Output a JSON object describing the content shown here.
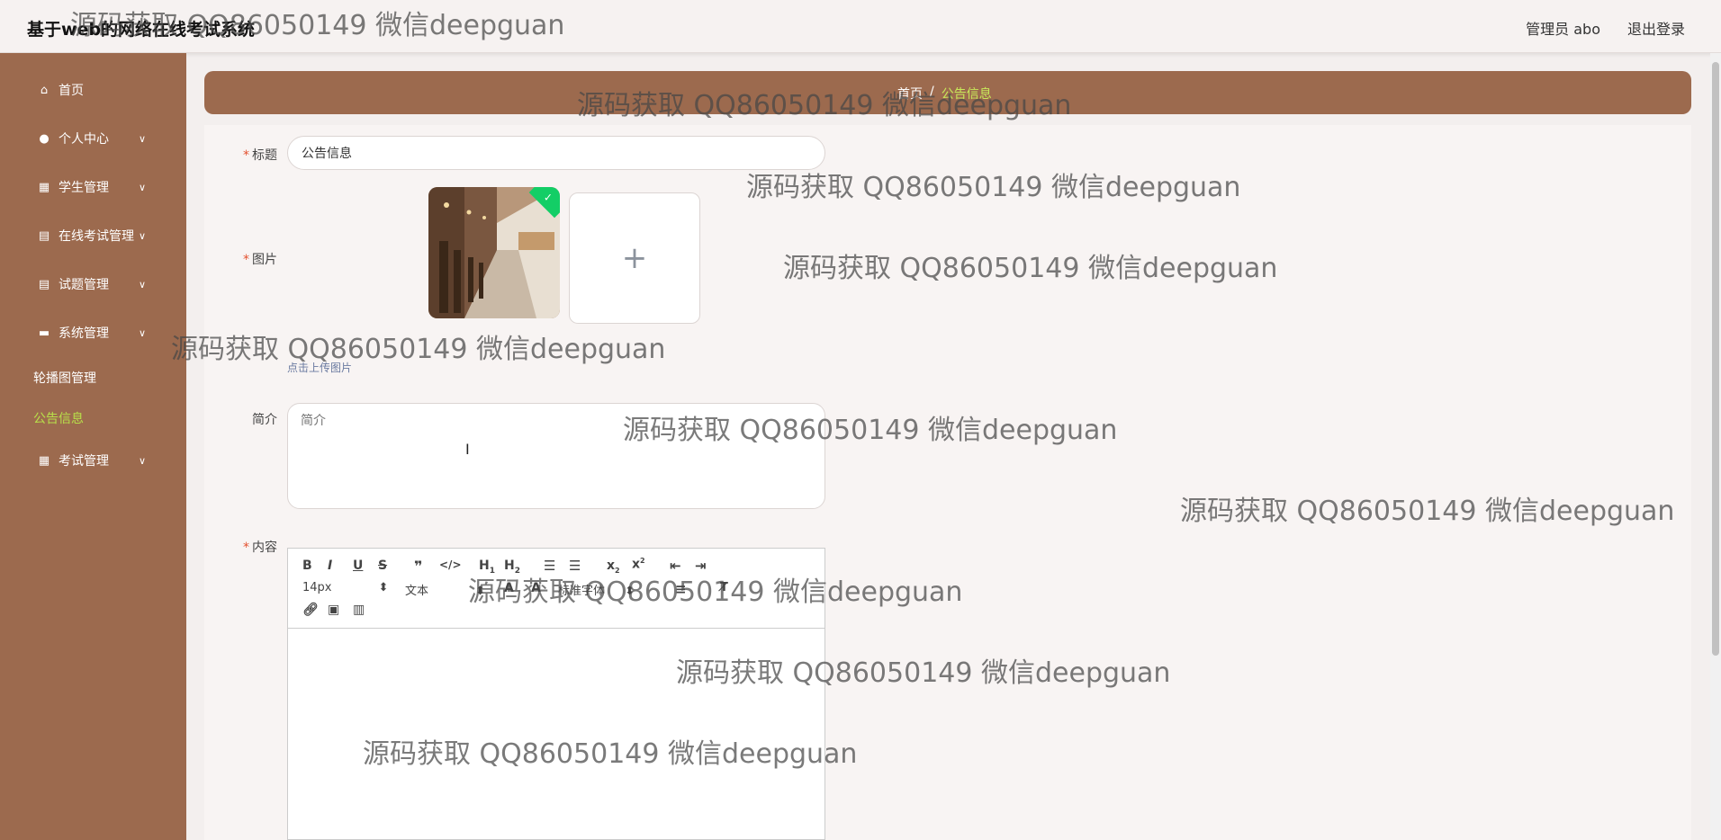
{
  "header": {
    "title": "基于web的网络在线考试系统",
    "user": "管理员 abo",
    "logout": "退出登录"
  },
  "sidebar": {
    "items": [
      {
        "label": "首页",
        "icon": "home-icon"
      },
      {
        "label": "个人中心",
        "icon": "user-icon"
      },
      {
        "label": "学生管理",
        "icon": "grid-icon"
      },
      {
        "label": "在线考试管理",
        "icon": "clipboard-icon"
      },
      {
        "label": "试题管理",
        "icon": "clipboard-icon"
      },
      {
        "label": "系统管理",
        "icon": "monitor-icon"
      },
      {
        "label": "考试管理",
        "icon": "grid-icon"
      }
    ],
    "sub_items": [
      {
        "label": "轮播图管理"
      },
      {
        "label": "公告信息"
      }
    ]
  },
  "breadcrumb": {
    "home": "首页",
    "separator": "/",
    "current": "公告信息"
  },
  "form": {
    "title_label": "标题",
    "title_value": "公告信息",
    "image_label": "图片",
    "upload_tip": "点击上传图片",
    "intro_label": "简介",
    "intro_placeholder": "简介",
    "content_label": "内容",
    "required_mark": "*"
  },
  "editor": {
    "font_size": "14px",
    "text_type": "文本",
    "font_family": "标准字体",
    "buttons": [
      "B",
      "I",
      "U",
      "S",
      "quote",
      "code",
      "H1",
      "H2",
      "ordered-list",
      "bullet-list",
      "subscript",
      "superscript",
      "outdent",
      "indent",
      "link",
      "image",
      "video"
    ]
  },
  "watermark": "源码获取 QQ86050149 微信deepguan",
  "colors": {
    "sidebar": "#9c6a4e",
    "accent_active": "#b8e04a",
    "required": "#e4512f"
  }
}
